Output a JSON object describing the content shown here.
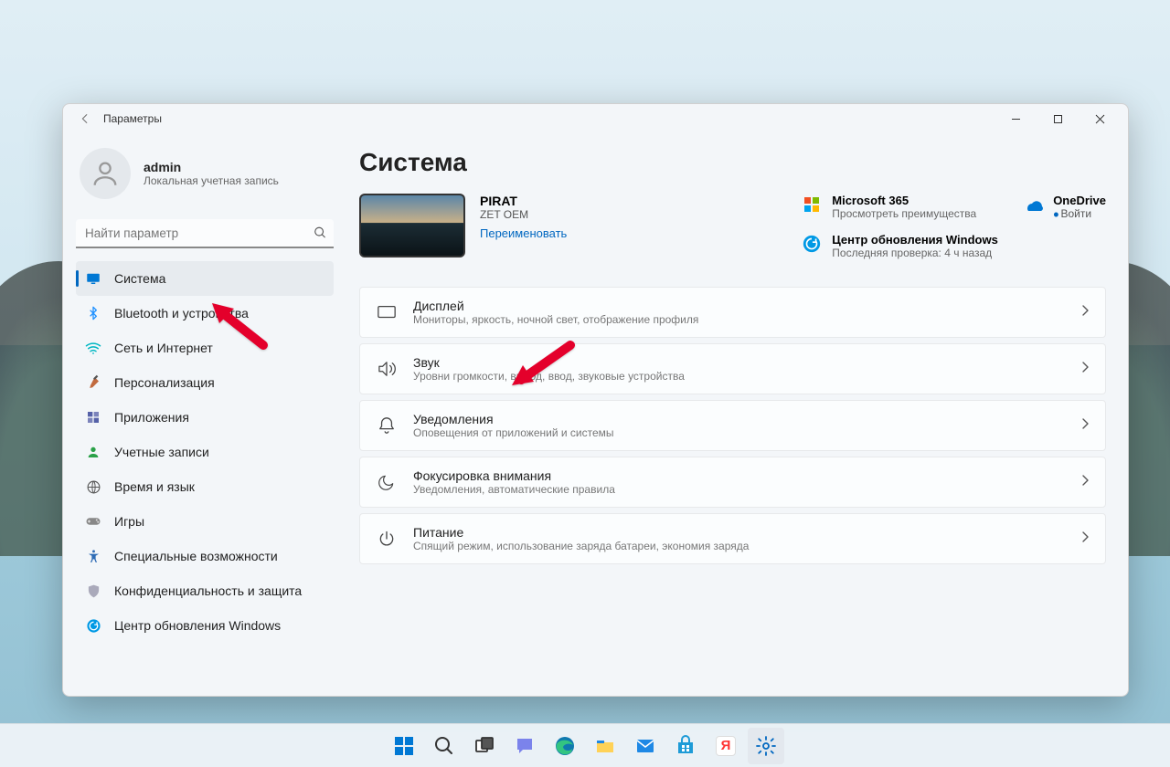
{
  "window": {
    "title": "Параметры"
  },
  "account": {
    "name": "admin",
    "subtitle": "Локальная учетная запись"
  },
  "search": {
    "placeholder": "Найти параметр"
  },
  "sidebar": {
    "items": [
      {
        "id": "system",
        "label": "Система",
        "icon": "display-icon",
        "color": "#0067c0",
        "active": true
      },
      {
        "id": "bluetooth",
        "label": "Bluetooth и устройства",
        "icon": "bluetooth-icon",
        "color": "#1e90ff"
      },
      {
        "id": "network",
        "label": "Сеть и Интернет",
        "icon": "wifi-icon",
        "color": "#00b7c3"
      },
      {
        "id": "personalization",
        "label": "Персонализация",
        "icon": "brush-icon",
        "color": "#c16a3f"
      },
      {
        "id": "apps",
        "label": "Приложения",
        "icon": "apps-icon",
        "color": "#5b5b8f"
      },
      {
        "id": "accounts",
        "label": "Учетные записи",
        "icon": "person-icon",
        "color": "#2aa148"
      },
      {
        "id": "time",
        "label": "Время и язык",
        "icon": "globe-icon",
        "color": "#555"
      },
      {
        "id": "gaming",
        "label": "Игры",
        "icon": "gamepad-icon",
        "color": "#555"
      },
      {
        "id": "accessibility",
        "label": "Специальные возможности",
        "icon": "accessibility-icon",
        "color": "#2d6bb5"
      },
      {
        "id": "privacy",
        "label": "Конфиденциальность и защита",
        "icon": "shield-icon",
        "color": "#888"
      },
      {
        "id": "update",
        "label": "Центр обновления Windows",
        "icon": "update-icon",
        "color": "#0099e5"
      }
    ]
  },
  "main": {
    "heading": "Система",
    "device": {
      "name": "PIRAT",
      "model": "ZET OEM",
      "rename": "Переименовать"
    },
    "cards": {
      "m365": {
        "title": "Microsoft 365",
        "sub": "Просмотреть преимущества"
      },
      "onedrive": {
        "title": "OneDrive",
        "sub": "Войти"
      },
      "update": {
        "title": "Центр обновления Windows",
        "sub": "Последняя проверка: 4 ч назад"
      }
    },
    "rows": [
      {
        "id": "display",
        "title": "Дисплей",
        "sub": "Мониторы, яркость, ночной свет, отображение профиля",
        "icon": "monitor-icon"
      },
      {
        "id": "sound",
        "title": "Звук",
        "sub": "Уровни громкости, вывод, ввод, звуковые устройства",
        "icon": "sound-icon"
      },
      {
        "id": "notifications",
        "title": "Уведомления",
        "sub": "Оповещения от приложений и системы",
        "icon": "bell-icon"
      },
      {
        "id": "focus",
        "title": "Фокусировка внимания",
        "sub": "Уведомления, автоматические правила",
        "icon": "moon-icon"
      },
      {
        "id": "power",
        "title": "Питание",
        "sub": "Спящий режим, использование заряда батареи, экономия заряда",
        "icon": "power-icon"
      }
    ]
  },
  "taskbar": {
    "items": [
      "start",
      "search",
      "taskview",
      "chat",
      "edge",
      "explorer",
      "mail",
      "store",
      "yandex",
      "settings"
    ]
  }
}
